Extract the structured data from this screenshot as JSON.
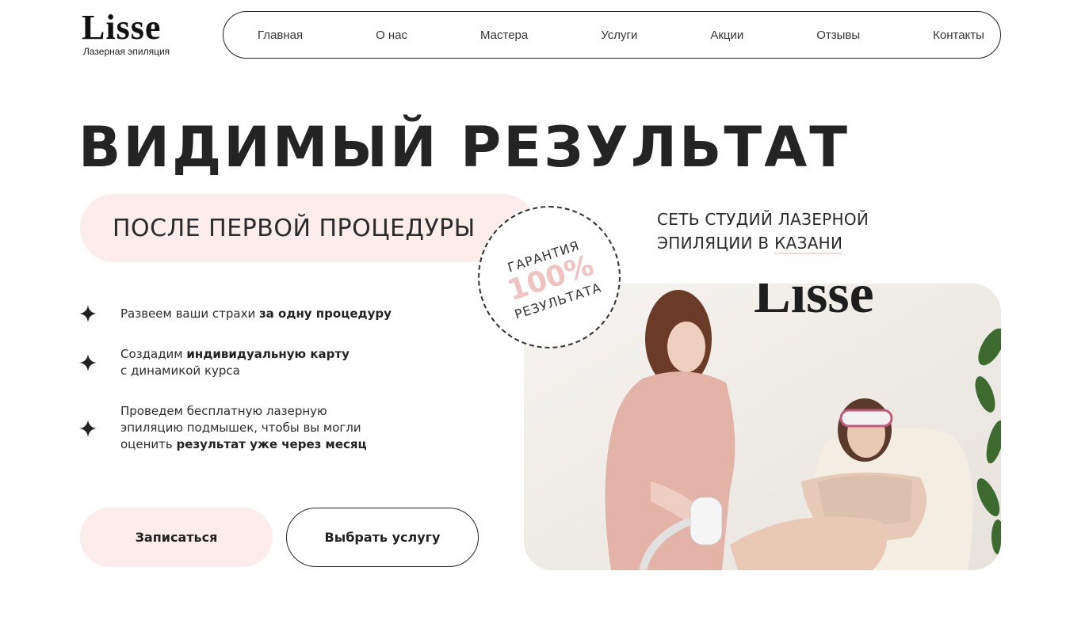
{
  "logo": {
    "word": "Lisse",
    "tagline": "Лазерная эпиляция"
  },
  "nav": {
    "items": [
      {
        "label": "Главная"
      },
      {
        "label": "О нас"
      },
      {
        "label": "Мастера"
      },
      {
        "label": "Услуги"
      },
      {
        "label": "Акции"
      },
      {
        "label": "Отзывы"
      },
      {
        "label": "Контакты"
      }
    ]
  },
  "hero": {
    "headline": "ВИДИМЫЙ РЕЗУЛЬТАТ",
    "pill_text": "ПОСЛЕ ПЕРВОЙ ПРОЦЕДУРЫ",
    "subtitle_line1": "СЕТЬ СТУДИЙ ЛАЗЕРНОЙ",
    "subtitle_line2_prefix": "ЭПИЛЯЦИИ В ",
    "subtitle_line2_highlight": "КАЗАНИ"
  },
  "badge": {
    "top": "ГАРАНТИЯ",
    "percent": "100%",
    "bottom": "РЕЗУЛЬТАТА",
    "accent_color": "#f0c3c3"
  },
  "features": [
    {
      "normal": "Развеем ваши страхи ",
      "bold": "за одну процедуру",
      "tail": ""
    },
    {
      "normal": "Создадим ",
      "bold": "индивидуальную карту",
      "tail": "с динамикой курса"
    },
    {
      "normal": "Проведем бесплатную лазерную эпиляцию подмышек, чтобы вы могли оценить ",
      "bold": "результат уже через месяц",
      "tail": ""
    }
  ],
  "buttons": {
    "primary": "Записаться",
    "secondary": "Выбрать услугу"
  },
  "photo": {
    "wall_logo": "Lisse"
  },
  "colors": {
    "accent_pink": "#fdecec",
    "text_dark": "#242424"
  },
  "icons": {
    "feature_bullet": "sparkle-star-icon"
  }
}
